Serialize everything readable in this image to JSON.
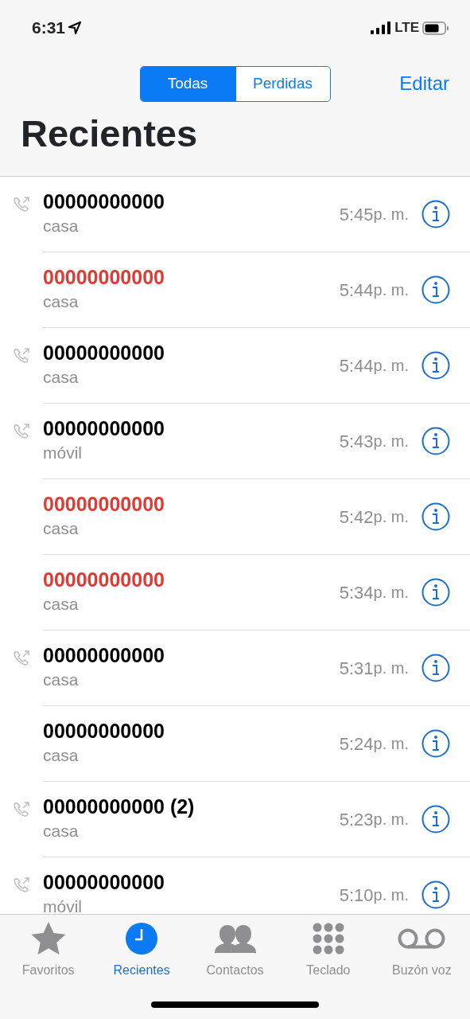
{
  "status_bar": {
    "time": "6:31",
    "network": "LTE"
  },
  "segments": [
    {
      "label": "Todas",
      "selected": true
    },
    {
      "label": "Perdidas",
      "selected": false
    }
  ],
  "edit_button": "Editar",
  "title": "Recientes",
  "calls": [
    {
      "number": "00000000000",
      "type": "casa",
      "time": "5:45",
      "period": "p. m.",
      "outgoing": true,
      "missed": false
    },
    {
      "number": "00000000000",
      "type": "casa",
      "time": "5:44",
      "period": "p. m.",
      "outgoing": false,
      "missed": true
    },
    {
      "number": "00000000000",
      "type": "casa",
      "time": "5:44",
      "period": "p. m.",
      "outgoing": true,
      "missed": false
    },
    {
      "number": "00000000000",
      "type": "móvil",
      "time": "5:43",
      "period": "p. m.",
      "outgoing": true,
      "missed": false
    },
    {
      "number": "00000000000",
      "type": "casa",
      "time": "5:42",
      "period": "p. m.",
      "outgoing": false,
      "missed": true
    },
    {
      "number": "00000000000",
      "type": "casa",
      "time": "5:34",
      "period": "p. m.",
      "outgoing": false,
      "missed": true
    },
    {
      "number": "00000000000",
      "type": "casa",
      "time": "5:31",
      "period": "p. m.",
      "outgoing": true,
      "missed": false
    },
    {
      "number": "00000000000",
      "type": "casa",
      "time": "5:24",
      "period": "p. m.",
      "outgoing": false,
      "missed": false
    },
    {
      "number": "00000000000 (2)",
      "type": "casa",
      "time": "5:23",
      "period": "p. m.",
      "outgoing": true,
      "missed": false
    },
    {
      "number": "00000000000",
      "type": "móvil",
      "time": "5:10",
      "period": "p. m.",
      "outgoing": true,
      "missed": false
    }
  ],
  "tab_bar": [
    {
      "label": "Favoritos",
      "kind": "star",
      "selected": false
    },
    {
      "label": "Recientes",
      "kind": "clock",
      "selected": true
    },
    {
      "label": "Contactos",
      "kind": "people",
      "selected": false
    },
    {
      "label": "Teclado",
      "kind": "keypad",
      "selected": false
    },
    {
      "label": "Buzón voz",
      "kind": "voicemail",
      "selected": false
    }
  ]
}
